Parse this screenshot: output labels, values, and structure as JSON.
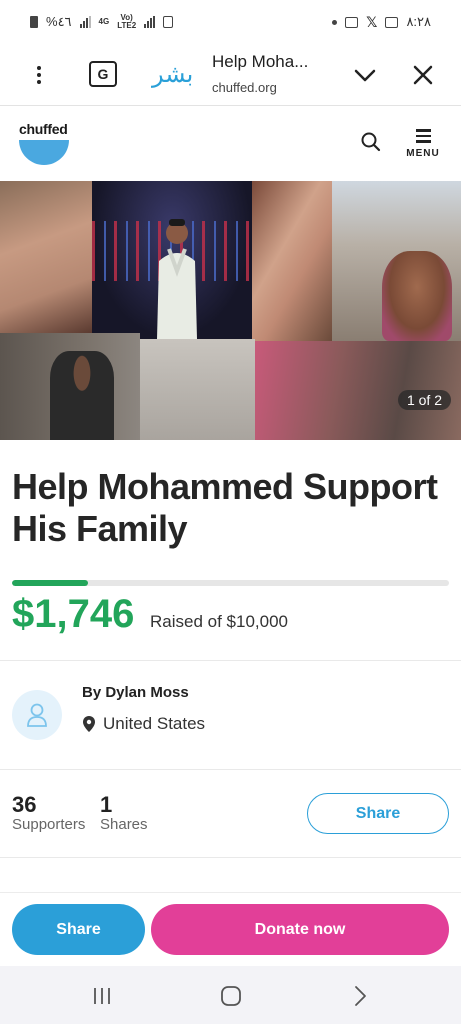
{
  "status_bar": {
    "time": "٨:٢٨",
    "battery": "%٤٦",
    "net1": "4G",
    "net2_top": "Vo)",
    "net2_bottom": "LTE2"
  },
  "browser": {
    "site_logo": "بشر",
    "page_title": "Help Moha...",
    "domain": "chuffed.org"
  },
  "site": {
    "brand": "chuffed",
    "menu_label": "MENU"
  },
  "gallery": {
    "counter": "1 of 2"
  },
  "campaign": {
    "title": "Help Mohammed Support His Family",
    "raised": "$1,746",
    "goal_text": "Raised of $10,000",
    "progress_fraction": 0.1746,
    "organizer": "By Dylan Moss",
    "location": "United States"
  },
  "stats": {
    "supporters_count": "36",
    "supporters_label": "Supporters",
    "shares_count": "1",
    "shares_label": "Shares",
    "share_button": "Share"
  },
  "actions": {
    "share": "Share",
    "donate": "Donate now"
  },
  "colors": {
    "green": "#22a55a",
    "blue": "#2b9fd8",
    "pink": "#e23f98"
  }
}
